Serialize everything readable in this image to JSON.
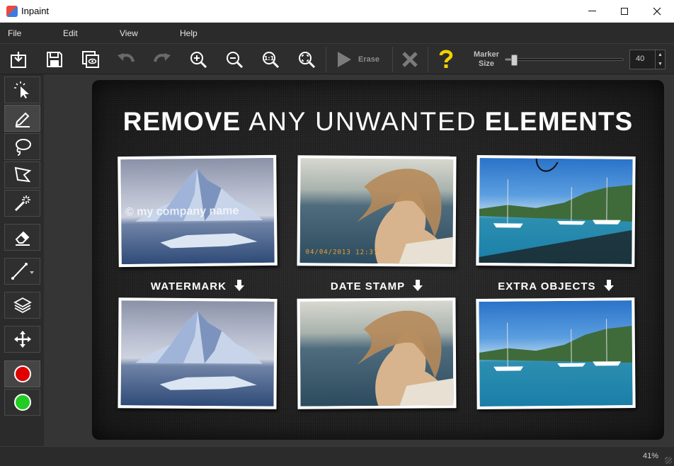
{
  "window": {
    "title": "Inpaint"
  },
  "menu": [
    "File",
    "Edit",
    "View",
    "Help"
  ],
  "toolbar": {
    "erase_label": "Erase",
    "marker_label_line1": "Marker",
    "marker_label_line2": "Size",
    "marker_size": "40",
    "marker_slider_fraction": 0.05
  },
  "colors": {
    "red_marker": "#e00000",
    "green_marker": "#22cc22",
    "help": "#f5d000"
  },
  "canvas": {
    "headline_bold1": "REMOVE",
    "headline_thin": "ANY UNWANTED",
    "headline_bold2": "ELEMENTS",
    "captions": [
      "WATERMARK",
      "DATE STAMP",
      "EXTRA OBJECTS"
    ],
    "watermark_text": "© my company name",
    "date_stamp_text": "04/04/2013 12:37"
  },
  "status": {
    "zoom": "41%"
  }
}
